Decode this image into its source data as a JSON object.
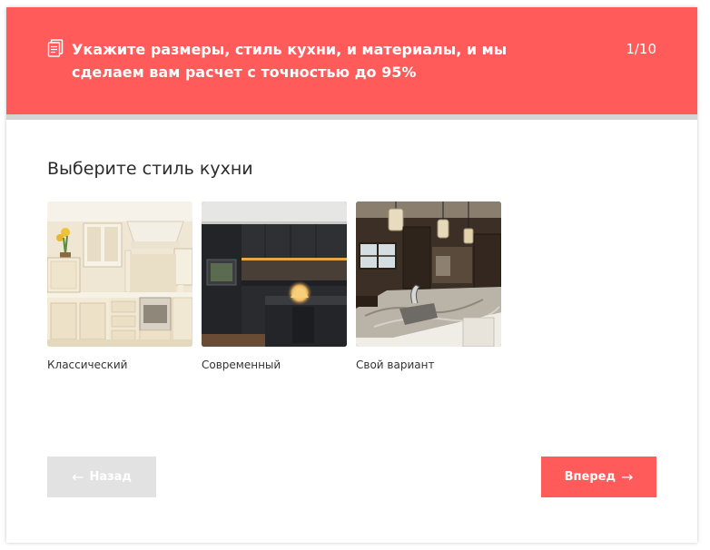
{
  "header": {
    "icon": "document-icon",
    "title": "Укажите размеры, стиль кухни, и материалы, и мы сделаем вам расчет с точностью до 95%",
    "step_counter": "1/10",
    "color": "#ff5b5b"
  },
  "question": {
    "title": "Выберите стиль кухни"
  },
  "options": [
    {
      "label": "Классический"
    },
    {
      "label": "Современный"
    },
    {
      "label": "Свой вариант"
    }
  ],
  "nav": {
    "back_label": "Назад",
    "back_arrow": "←",
    "next_label": "Вперед",
    "next_arrow": "→"
  }
}
